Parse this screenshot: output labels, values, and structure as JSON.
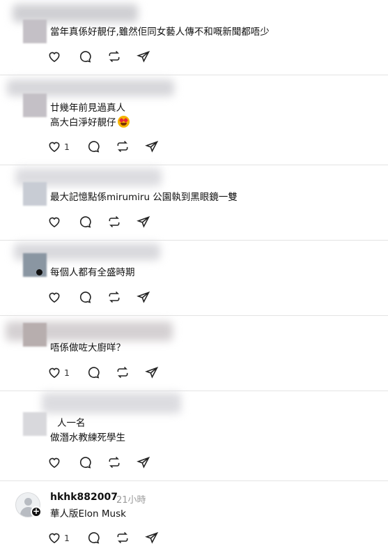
{
  "posts": [
    {
      "lines": [
        "當年真係好靚仔,雖然佢同女藝人傳不和嘅新聞都唔少"
      ],
      "likes": ""
    },
    {
      "lines": [
        "廿幾年前見過真人",
        "高大白淨好靚仔"
      ],
      "likes": "1",
      "emoji": "star-struck-emoji"
    },
    {
      "lines": [
        "最大記憶點係mirumiru 公園執到黑眼鏡一雙"
      ],
      "likes": ""
    },
    {
      "lines": [
        "每個人都有全盛時期"
      ],
      "likes": ""
    },
    {
      "lines": [
        "唔係做咗大廚咩？"
      ],
      "likes": "1"
    },
    {
      "lines": [
        "人一名",
        "做潛水教練死學生"
      ],
      "likes": ""
    },
    {
      "username": "hkhk882007",
      "time": "21小時",
      "lines": [
        "華人版Elon Musk"
      ],
      "likes": "1"
    }
  ],
  "icons": {
    "like": "heart-icon",
    "reply": "comment-icon",
    "repost": "repost-icon",
    "share": "send-icon",
    "follow": "plus-icon",
    "avatar": "default-avatar-icon"
  }
}
